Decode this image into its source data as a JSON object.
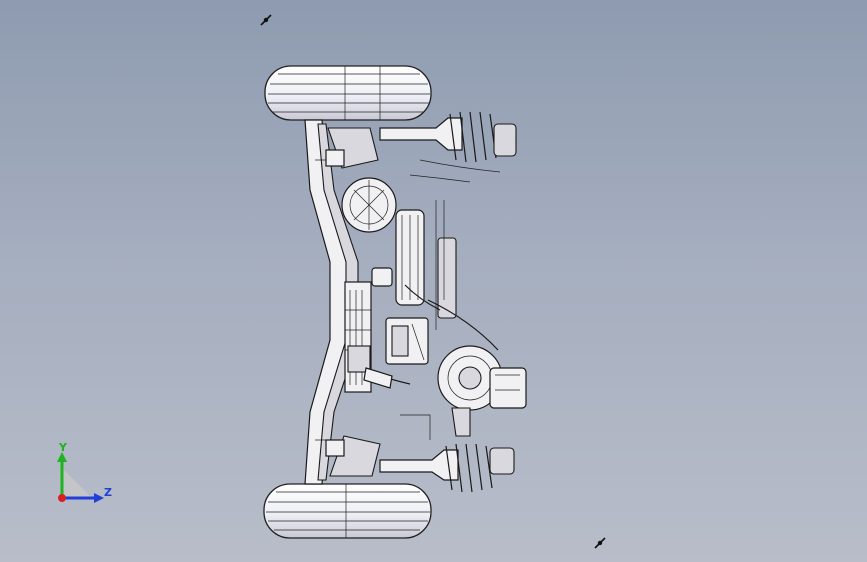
{
  "viewport": {
    "background_top": "#8e9bb0",
    "background_bottom": "#b8bdc9"
  },
  "triad": {
    "y_label": "Y",
    "z_label": "Z",
    "y_color": "#1fb31f",
    "z_color": "#1f3fd6",
    "x_color": "#d91f1f"
  },
  "markers": [
    {
      "icon": "light-source-icon"
    },
    {
      "icon": "light-source-icon"
    }
  ]
}
